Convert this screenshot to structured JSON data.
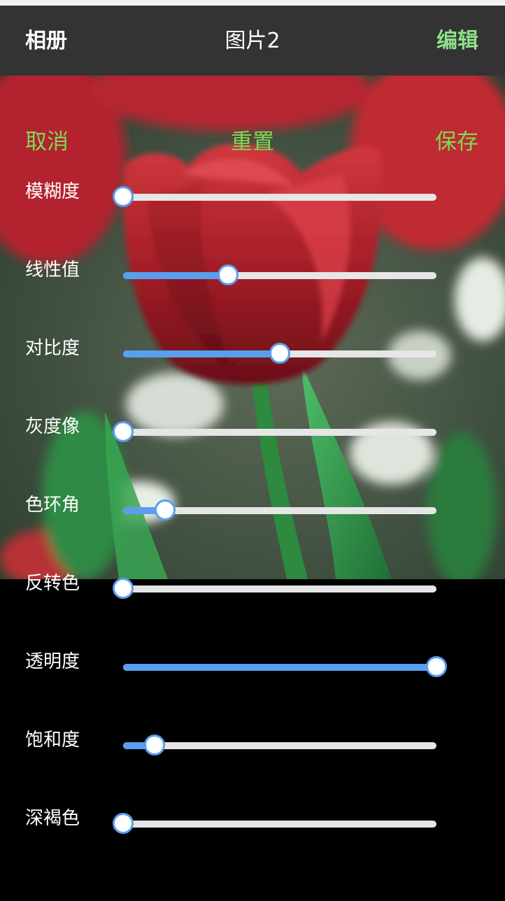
{
  "navbar": {
    "back_label": "相册",
    "title": "图片2",
    "edit_label": "编辑",
    "bg_color": "#333333",
    "edit_color": "#8ee08a"
  },
  "photo": {
    "subject": "red tulips with green leaves"
  },
  "actions": {
    "cancel_label": "取消",
    "reset_label": "重置",
    "save_label": "保存",
    "color": "#7ed957"
  },
  "sliders": [
    {
      "label": "模糊度",
      "level": 0.0
    },
    {
      "label": "线性值",
      "level": 0.335
    },
    {
      "label": "对比度",
      "level": 0.5
    },
    {
      "label": "灰度像",
      "level": 0.0
    },
    {
      "label": "色环角",
      "level": 0.135
    },
    {
      "label": "反转色",
      "level": 0.0
    },
    {
      "label": "透明度",
      "level": 1.0
    },
    {
      "label": "饱和度",
      "level": 0.1
    },
    {
      "label": "深褐色",
      "level": 0.0
    }
  ],
  "slider_style": {
    "track_color": "#e6e6e6",
    "fill_color": "#5a9ef0",
    "thumb_color": "#ffffff"
  }
}
